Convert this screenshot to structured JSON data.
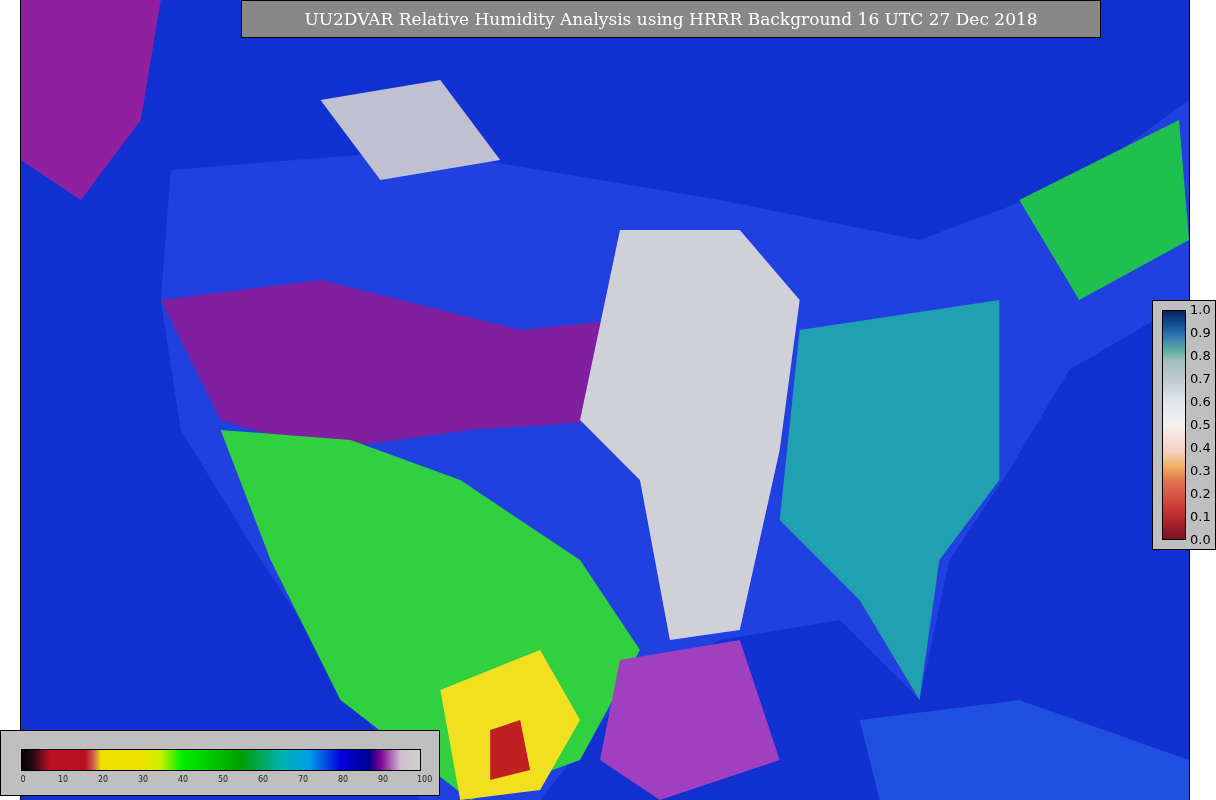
{
  "title": "UU2DVAR Relative Humidity Analysis using HRRR Background 16 UTC 27 Dec 2018",
  "humidity_legend": {
    "ticks": [
      "0",
      "10",
      "20",
      "30",
      "40",
      "50",
      "60",
      "70",
      "80",
      "90",
      "100"
    ]
  },
  "station_legend": {
    "ticks": [
      "1.0",
      "0.9",
      "0.8",
      "0.7",
      "0.6",
      "0.5",
      "0.4",
      "0.3",
      "0.2",
      "0.1",
      "0.0"
    ]
  }
}
